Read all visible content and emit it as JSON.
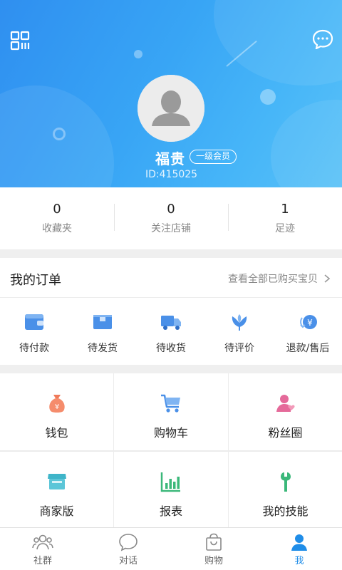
{
  "header": {
    "username": "福贵",
    "member_level": "一级会员",
    "user_id": "ID:415025",
    "qr_icon": "qr-grid-icon",
    "message_icon": "chat-bubble-icon",
    "avatar_icon": "person-silhouette-icon"
  },
  "stats": [
    {
      "value": "0",
      "label": "收藏夹"
    },
    {
      "value": "0",
      "label": "关注店铺"
    },
    {
      "value": "1",
      "label": "足迹"
    }
  ],
  "orders": {
    "title": "我的订单",
    "view_all": "查看全部已购买宝贝",
    "items": [
      {
        "label": "待付款",
        "icon": "wallet-icon"
      },
      {
        "label": "待发货",
        "icon": "box-icon"
      },
      {
        "label": "待收货",
        "icon": "truck-icon"
      },
      {
        "label": "待评价",
        "icon": "flower-icon"
      },
      {
        "label": "退款/售后",
        "icon": "refund-yen-icon"
      }
    ]
  },
  "grid": [
    {
      "label": "钱包",
      "icon": "money-bag-icon"
    },
    {
      "label": "购物车",
      "icon": "cart-icon"
    },
    {
      "label": "粉丝圈",
      "icon": "fans-icon"
    },
    {
      "label": "商家版",
      "icon": "store-icon"
    },
    {
      "label": "报表",
      "icon": "chart-icon"
    },
    {
      "label": "我的技能",
      "icon": "wrench-icon"
    }
  ],
  "tabs": [
    {
      "label": "社群",
      "icon": "community-icon",
      "active": false
    },
    {
      "label": "对话",
      "icon": "chat-icon",
      "active": false
    },
    {
      "label": "购物",
      "icon": "shopping-bag-icon",
      "active": false
    },
    {
      "label": "我",
      "icon": "me-icon",
      "active": true
    }
  ],
  "colors": {
    "accent": "#1f8de8",
    "header_gradient_start": "#2f8ff0",
    "header_gradient_end": "#59c1f7"
  }
}
